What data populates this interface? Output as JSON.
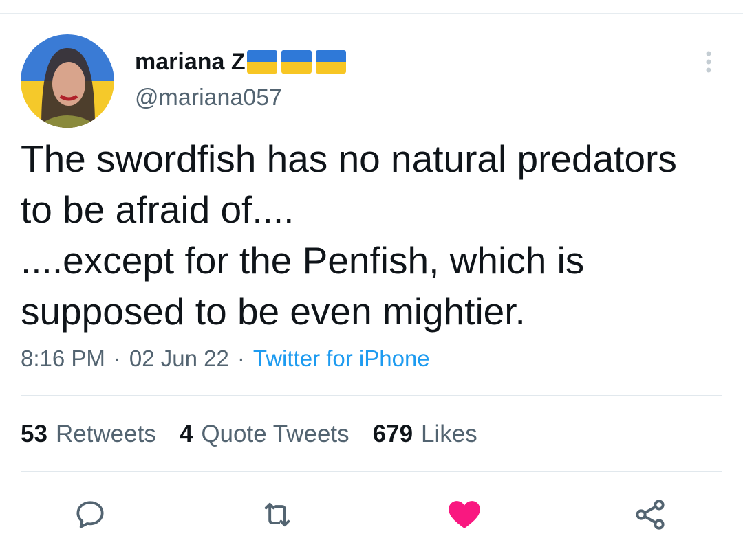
{
  "author": {
    "display_name": "mariana Z",
    "flags": [
      "ukraine-flag",
      "ukraine-flag",
      "ukraine-flag"
    ],
    "handle": "@mariana057"
  },
  "tweet": {
    "lines": [
      "The swordfish has no natural predators to be afraid of....",
      "....except for the Penfish, which is supposed to be even mightier."
    ],
    "time": "8:16 PM",
    "date": "02 Jun 22",
    "separator": "·",
    "source": "Twitter for iPhone"
  },
  "stats": {
    "retweets_count": "53",
    "retweets_label": "Retweets",
    "quotes_count": "4",
    "quotes_label": "Quote Tweets",
    "likes_count": "679",
    "likes_label": "Likes"
  },
  "actions": {
    "reply_icon": "comment-icon",
    "retweet_icon": "retweet-icon",
    "like_icon": "heart-icon",
    "share_icon": "share-icon"
  },
  "colors": {
    "text": "#0f1419",
    "secondary": "#536471",
    "link": "#1d9bf0",
    "like": "#f91880",
    "flag_blue": "#2f79d8",
    "flag_yellow": "#f7c624"
  }
}
